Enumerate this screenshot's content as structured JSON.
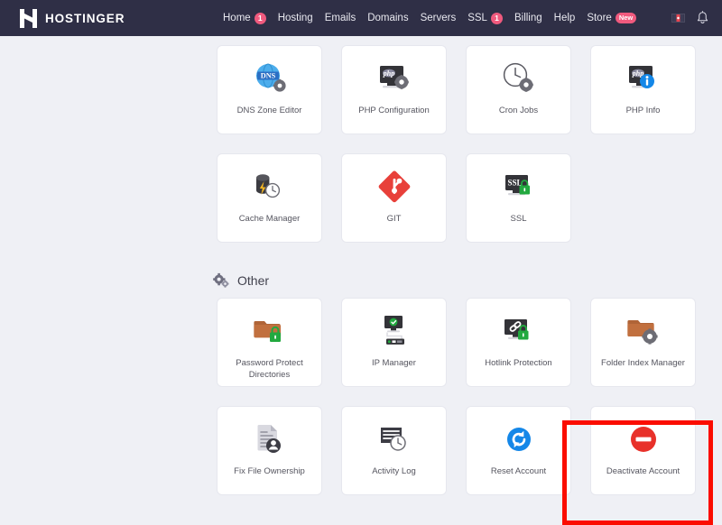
{
  "brand": {
    "name": "HOSTINGER",
    "logo_icon": "hostinger-h-logo",
    "navbar_color": "#2f2f46",
    "accent_color": "#f05a7e"
  },
  "nav": {
    "items": [
      {
        "label": "Home",
        "badge": "1"
      },
      {
        "label": "Hosting",
        "badge": ""
      },
      {
        "label": "Emails",
        "badge": ""
      },
      {
        "label": "Domains",
        "badge": ""
      },
      {
        "label": "Servers",
        "badge": ""
      },
      {
        "label": "SSL",
        "badge": "1"
      },
      {
        "label": "Billing",
        "badge": ""
      },
      {
        "label": "Help",
        "badge": ""
      },
      {
        "label": "Store",
        "badge": "New"
      }
    ],
    "right_icons": [
      "flag-icon",
      "notification-bell-icon"
    ]
  },
  "advanced_cards": [
    {
      "label": "DNS Zone Editor",
      "icon": "dns-globe-gear-icon"
    },
    {
      "label": "PHP Configuration",
      "icon": "php-screen-gear-icon"
    },
    {
      "label": "Cron Jobs",
      "icon": "clock-gear-icon"
    },
    {
      "label": "PHP Info",
      "icon": "php-screen-info-icon"
    },
    {
      "label": "Cache Manager",
      "icon": "database-bolt-clock-icon"
    },
    {
      "label": "GIT",
      "icon": "git-diamond-icon"
    },
    {
      "label": "SSL",
      "icon": "ssl-screen-lock-icon"
    }
  ],
  "other_section": {
    "title": "Other",
    "icon": "gears-icon",
    "cards": [
      {
        "label": "Password Protect Directories",
        "icon": "folder-lock-icon"
      },
      {
        "label": "IP Manager",
        "icon": "monitor-server-icon"
      },
      {
        "label": "Hotlink Protection",
        "icon": "monitor-link-lock-icon"
      },
      {
        "label": "Folder Index Manager",
        "icon": "folder-gear-icon"
      },
      {
        "label": "Fix File Ownership",
        "icon": "document-person-icon"
      },
      {
        "label": "Activity Log",
        "icon": "log-clock-icon"
      },
      {
        "label": "Reset Account",
        "icon": "refresh-circle-icon"
      },
      {
        "label": "Deactivate Account",
        "icon": "minus-circle-icon"
      }
    ]
  },
  "annotation": {
    "target": "Deactivate Account",
    "color": "#fb0d00"
  }
}
